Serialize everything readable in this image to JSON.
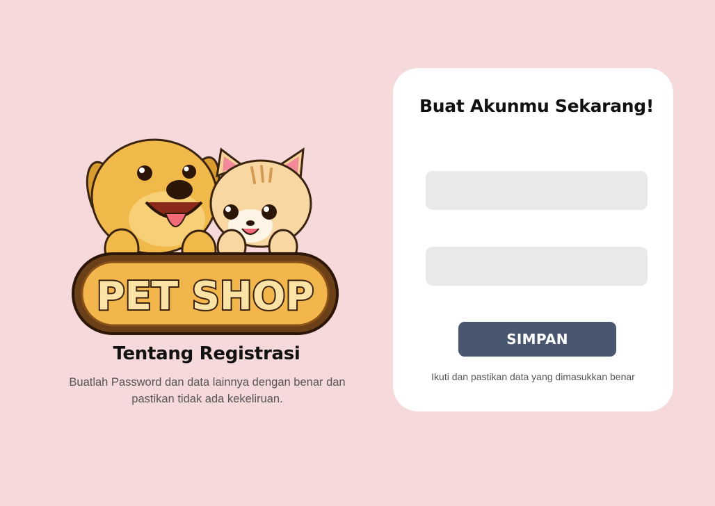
{
  "logo": {
    "brand_text": "PET SHOP",
    "icon": "pet-shop-logo"
  },
  "about": {
    "title": "Tentang Registrasi",
    "description": "Buatlah Password dan data lainnya dengan benar dan pastikan tidak ada kekeliruan."
  },
  "form": {
    "title": "Buat Akunmu Sekarang!",
    "field1": {
      "value": "",
      "placeholder": ""
    },
    "field2": {
      "value": "",
      "placeholder": ""
    },
    "submit_label": "SIMPAN",
    "hint": "Ikuti dan pastikan data yang dimasukkan benar"
  },
  "colors": {
    "background": "#f6d9da",
    "card": "#ffffff",
    "button": "#485670",
    "field": "#e9e9e9"
  }
}
